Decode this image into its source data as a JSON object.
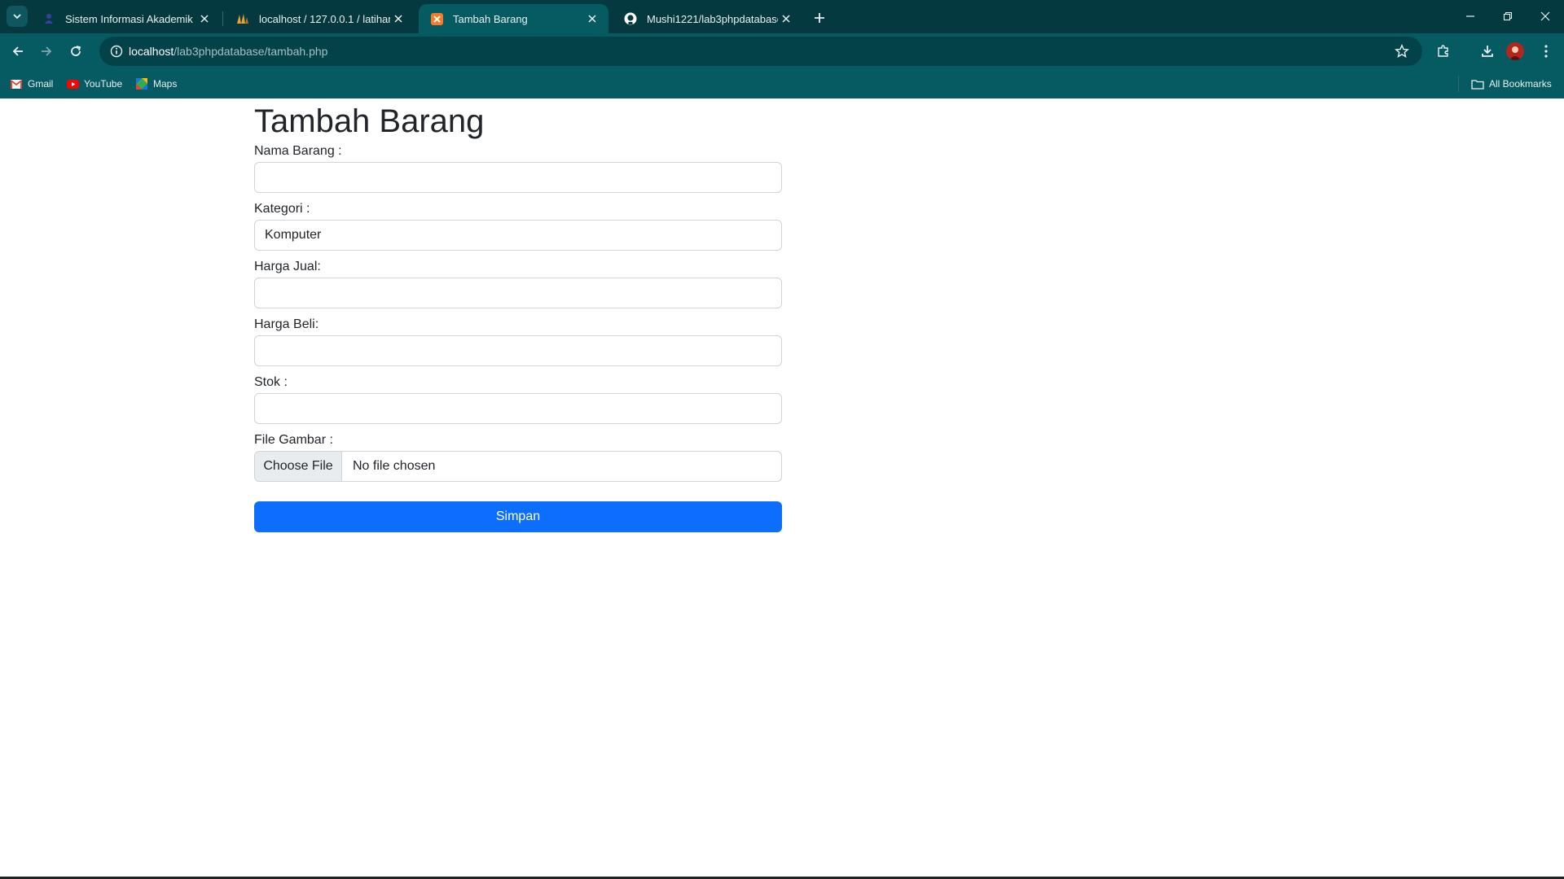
{
  "browser": {
    "tabs": [
      {
        "title": "Sistem Informasi Akademik",
        "active": false,
        "favicon": "akademik-icon"
      },
      {
        "title": "localhost / 127.0.0.1 / latihan1 /",
        "active": false,
        "favicon": "phpmyadmin-icon"
      },
      {
        "title": "Tambah Barang",
        "active": true,
        "favicon": "xampp-icon"
      },
      {
        "title": "Mushi1221/lab3phpdatabase",
        "active": false,
        "favicon": "github-icon"
      }
    ],
    "url_host": "localhost",
    "url_path": "/lab3phpdatabase/tambah.php",
    "bookmarks": [
      "Gmail",
      "YouTube",
      "Maps"
    ],
    "all_bookmarks": "All Bookmarks",
    "colors": {
      "frame": "#04393f",
      "toolbar": "#065a61",
      "omnibox": "#044249"
    }
  },
  "page": {
    "title": "Tambah Barang",
    "fields": {
      "nama_label": "Nama Barang :",
      "nama_value": "",
      "kategori_label": "Kategori :",
      "kategori_value": "Komputer",
      "harga_jual_label": "Harga Jual:",
      "harga_jual_value": "",
      "harga_beli_label": "Harga Beli:",
      "harga_beli_value": "",
      "stok_label": "Stok :",
      "stok_value": "",
      "gambar_label": "File Gambar :",
      "file_button": "Choose File",
      "file_status": "No file chosen"
    },
    "submit_label": "Simpan",
    "colors": {
      "primary": "#0d6efd",
      "text": "#212529",
      "border": "#ced4da"
    }
  }
}
